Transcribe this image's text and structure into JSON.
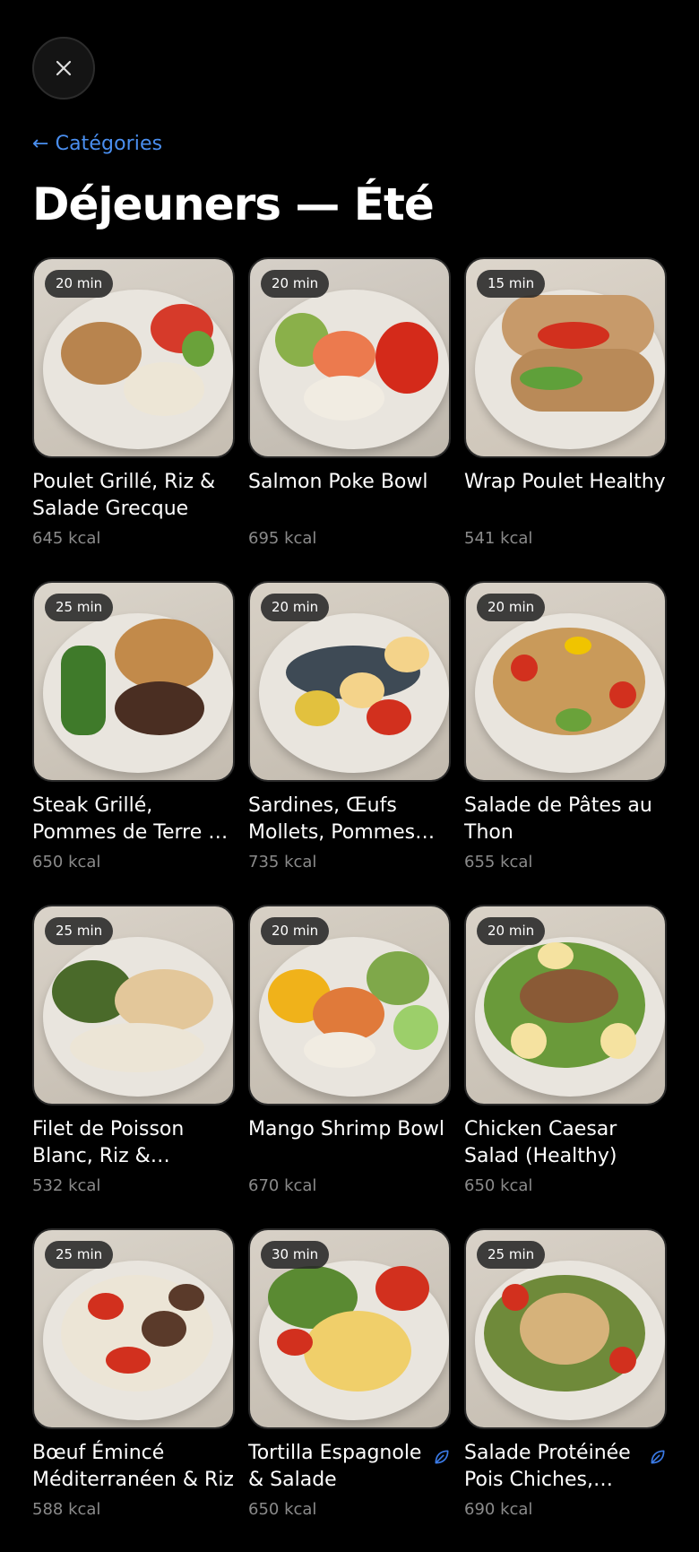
{
  "header": {
    "back_label": "← Catégories",
    "title": "Déjeuners — Été"
  },
  "icons": {
    "close": "close-icon",
    "leaf": "leaf-icon",
    "leaf_color": "#3b7be8"
  },
  "colors": {
    "background": "#000000",
    "accent": "#4a8ff0",
    "muted_text": "#8a8a8a"
  },
  "meals": [
    {
      "time": "20 min",
      "name": "Poulet Grillé, Riz & Salade Grecque",
      "kcal": "645 kcal",
      "leaf": false
    },
    {
      "time": "20 min",
      "name": "Salmon Poke Bowl",
      "kcal": "695 kcal",
      "leaf": false
    },
    {
      "time": "15 min",
      "name": "Wrap Poulet Healthy",
      "kcal": "541 kcal",
      "leaf": false
    },
    {
      "time": "25 min",
      "name": "Steak Grillé, Pommes de Terre & Haricots…",
      "kcal": "650 kcal",
      "leaf": false
    },
    {
      "time": "20 min",
      "name": "Sardines, Œufs Mollets, Pommes d…",
      "kcal": "735 kcal",
      "leaf": false
    },
    {
      "time": "20 min",
      "name": "Salade de Pâtes au Thon",
      "kcal": "655 kcal",
      "leaf": false
    },
    {
      "time": "25 min",
      "name": "Filet de Poisson Blanc, Riz &…",
      "kcal": "532 kcal",
      "leaf": false
    },
    {
      "time": "20 min",
      "name": "Mango Shrimp Bowl",
      "kcal": "670 kcal",
      "leaf": false
    },
    {
      "time": "20 min",
      "name": "Chicken Caesar Salad (Healthy)",
      "kcal": "650 kcal",
      "leaf": false
    },
    {
      "time": "25 min",
      "name": "Bœuf Émincé Méditerranéen & Riz",
      "kcal": "588 kcal",
      "leaf": false
    },
    {
      "time": "30 min",
      "name": "Tortilla Espagnole & Salade",
      "kcal": "650 kcal",
      "leaf": true
    },
    {
      "time": "25 min",
      "name": "Salade Protéinée Pois Chiches,…",
      "kcal": "690 kcal",
      "leaf": true
    }
  ]
}
